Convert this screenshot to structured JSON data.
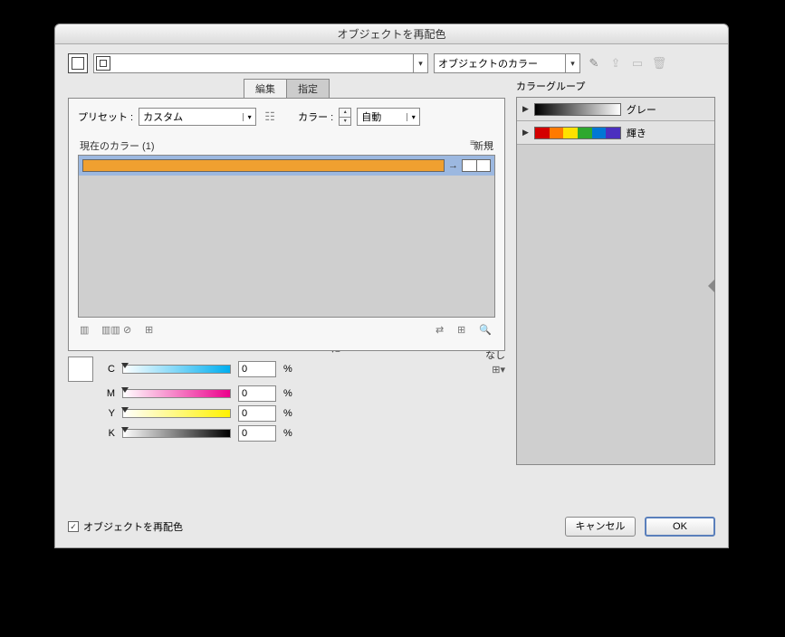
{
  "title": "オブジェクトを再配色",
  "top": {
    "label_combo": "オブジェクトのカラー"
  },
  "tabs": {
    "edit": "編集",
    "assign": "指定"
  },
  "preset": {
    "label": "プリセット :",
    "value": "カスタム",
    "color_label": "カラー :",
    "color_value": "自動"
  },
  "colorlist": {
    "current_label": "現在のカラー (1)",
    "new_label": "新規"
  },
  "none_label": "なし",
  "cmyk": {
    "c": {
      "label": "C",
      "value": "0"
    },
    "m": {
      "label": "M",
      "value": "0"
    },
    "y": {
      "label": "Y",
      "value": "0"
    },
    "k": {
      "label": "K",
      "value": "0"
    },
    "pct": "%"
  },
  "groups": {
    "label": "カラーグループ",
    "items": [
      {
        "label": "グレー",
        "type": "gray"
      },
      {
        "label": "輝き",
        "type": "rainbow"
      }
    ]
  },
  "rainbow_colors": [
    "#d40000",
    "#ff7a00",
    "#ffe100",
    "#2ea82e",
    "#0077d4",
    "#4b2fbf"
  ],
  "footer": {
    "checkbox": "オブジェクトを再配色",
    "cancel": "キャンセル",
    "ok": "OK"
  }
}
